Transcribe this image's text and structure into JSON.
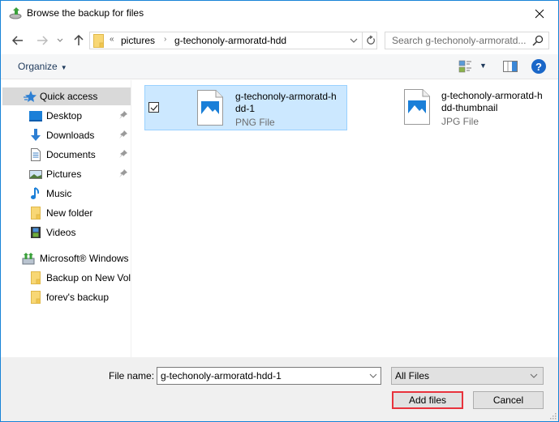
{
  "window": {
    "title": "Browse the backup for files",
    "icon": "backup-drive-icon"
  },
  "nav": {
    "back_icon": "arrow-left-icon",
    "forward_icon": "arrow-right-icon",
    "recent_icon": "chevron-down-icon",
    "up_icon": "arrow-up-icon",
    "address": {
      "overflow": "«",
      "segments": [
        "pictures",
        "g-techonoly-armoratd-hdd"
      ],
      "separator": "›"
    },
    "search_placeholder": "Search g-techonoly-armoratd..."
  },
  "commandbar": {
    "organize_label": "Organize",
    "caret": "▼"
  },
  "sidebar": {
    "items": [
      {
        "label": "Quick access",
        "icon": "star-icon",
        "pinned": false,
        "selected": true
      },
      {
        "label": "Desktop",
        "icon": "desktop-icon",
        "pinned": true
      },
      {
        "label": "Downloads",
        "icon": "download-icon",
        "pinned": true
      },
      {
        "label": "Documents",
        "icon": "document-icon",
        "pinned": true
      },
      {
        "label": "Pictures",
        "icon": "pictures-icon",
        "pinned": true
      },
      {
        "label": "Music",
        "icon": "music-icon",
        "pinned": false
      },
      {
        "label": "New folder",
        "icon": "folder-icon",
        "pinned": false
      },
      {
        "label": "Videos",
        "icon": "videos-icon",
        "pinned": false
      },
      {
        "label": "Microsoft® Windows",
        "icon": "backup-drive-icon",
        "pinned": false
      },
      {
        "label": "Backup on New Vol",
        "icon": "folder-icon",
        "pinned": false
      },
      {
        "label": "forev's backup",
        "icon": "folder-icon",
        "pinned": false
      }
    ]
  },
  "files": [
    {
      "name_line1": "g-techonoly-armoratd-h",
      "name_line2": "dd-1",
      "type": "PNG File",
      "selected": true,
      "checked": true
    },
    {
      "name_line1": "g-techonoly-armoratd-h",
      "name_line2": "dd-thumbnail",
      "type": "JPG File",
      "selected": false,
      "checked": false
    }
  ],
  "footer": {
    "file_name_label": "File name:",
    "file_name_value": "g-techonoly-armoratd-hdd-1",
    "file_type_value": "All Files",
    "add_button": "Add files",
    "cancel_button": "Cancel"
  },
  "colors": {
    "accent": "#1883d7",
    "selection": "#cce8ff",
    "highlight_border": "#e8323c"
  }
}
